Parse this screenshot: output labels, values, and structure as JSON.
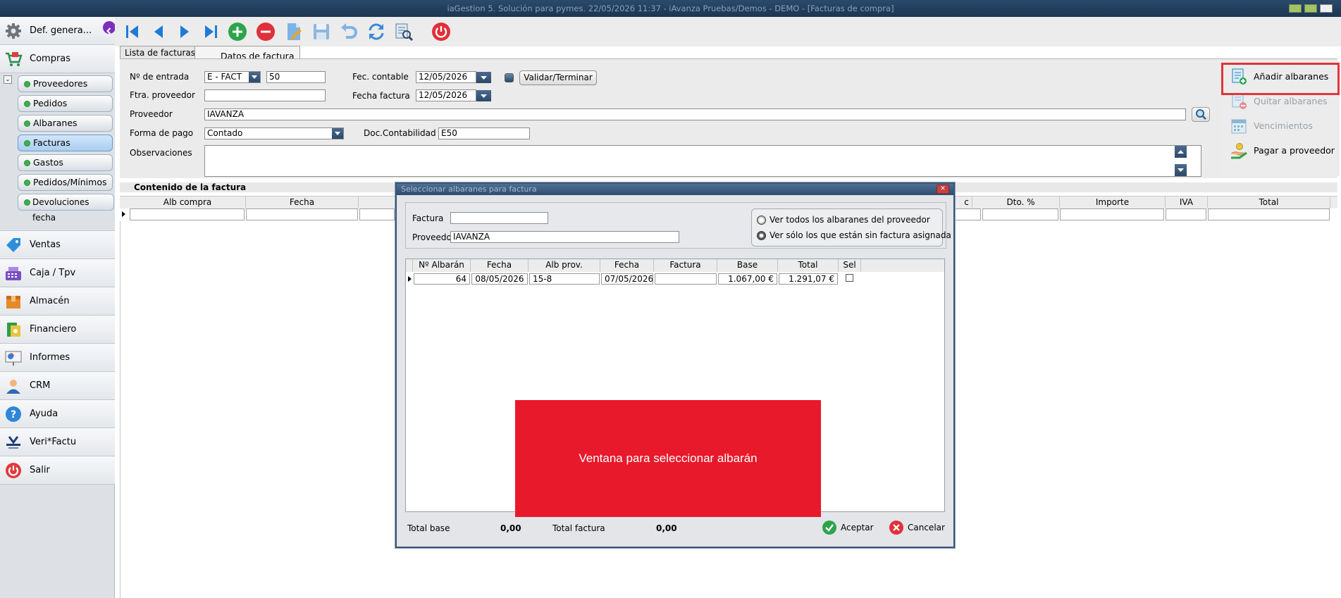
{
  "window": {
    "title": "iaGestion 5. Solución para pymes.  22/05/2026 11:37  - iAvanza Pruebas/Demos - DEMO - [Facturas de compra]"
  },
  "sidebar": {
    "modules_top": [
      {
        "label": "Def. genera..."
      },
      {
        "label": "Compras"
      }
    ],
    "submenu": [
      {
        "label": "Proveedores"
      },
      {
        "label": "Pedidos"
      },
      {
        "label": "Albaranes"
      },
      {
        "label": "Facturas"
      },
      {
        "label": "Gastos"
      },
      {
        "label": "Pedidos/Mínimos"
      },
      {
        "label": "Devoluciones fecha"
      }
    ],
    "modules_bottom": [
      {
        "label": "Ventas"
      },
      {
        "label": "Caja / Tpv"
      },
      {
        "label": "Almacén"
      },
      {
        "label": "Financiero"
      },
      {
        "label": "Informes"
      },
      {
        "label": "CRM"
      },
      {
        "label": "Ayuda"
      },
      {
        "label": "Veri*Factu"
      },
      {
        "label": "Salir"
      }
    ]
  },
  "tabs": [
    {
      "label": "Lista de facturas"
    },
    {
      "label": "Datos de factura"
    }
  ],
  "form": {
    "entry_label": "Nº de entrada",
    "entry_series": "E   - FACT",
    "entry_number": "50",
    "accounting_date_label": "Fec. contable",
    "accounting_date": "12/05/2026",
    "validate_button": "Validar/Terminar",
    "supplier_invoice_label": "Ftra. proveedor",
    "supplier_invoice": "",
    "invoice_date_label": "Fecha factura",
    "invoice_date": "12/05/2026",
    "supplier_label": "Proveedor",
    "supplier": "IAVANZA",
    "payment_label": "Forma de pago",
    "payment": "Contado",
    "doc_label": "Doc.Contabilidad",
    "doc": "E50",
    "notes_label": "Observaciones"
  },
  "actions": [
    {
      "label": "Añadir albaranes",
      "enabled": true
    },
    {
      "label": "Quitar albaranes",
      "enabled": false
    },
    {
      "label": "Vencimientos",
      "enabled": false
    },
    {
      "label": "Pagar a proveedor",
      "enabled": true
    }
  ],
  "invoice_section": {
    "title": "Contenido de la factura",
    "columns": [
      "Alb compra",
      "Fecha",
      "c",
      "Dto. %",
      "Importe",
      "IVA",
      "Total"
    ]
  },
  "dialog": {
    "title": "Seleccionar albaranes para factura",
    "invoice_label": "Factura",
    "invoice_value": "",
    "supplier_label": "Proveedor",
    "supplier_value": "IAVANZA",
    "radio_all": "Ver todos los albaranes del proveedor",
    "radio_unassigned": "Ver sólo los que están sin factura asignada",
    "columns": [
      "Nº Albarán",
      "Fecha",
      "Alb prov.",
      "Fecha",
      "Factura",
      "Base",
      "Total",
      "Sel"
    ],
    "rows": [
      {
        "num": "64",
        "date": "08/05/2026",
        "alb_prov": "15-8",
        "date2": "07/05/2026",
        "invoice": "",
        "base": "1.067,00 €",
        "total": "1.291,07 €"
      }
    ],
    "overlay_text": "Ventana para seleccionar albarán",
    "total_base_label": "Total base",
    "total_base": "0,00",
    "total_invoice_label": "Total factura",
    "total_invoice": "0,00",
    "accept": "Aceptar",
    "cancel": "Cancelar"
  },
  "colors": {
    "accent_red": "#e0353a",
    "overlay_red": "#e8192b",
    "title_bar": "#2b4a6c",
    "status_green": "#3bb34a"
  }
}
